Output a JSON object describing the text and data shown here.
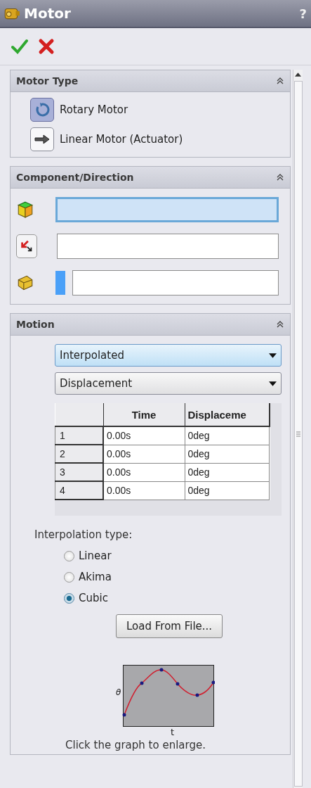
{
  "window": {
    "title": "Motor",
    "help": "?"
  },
  "sections": [
    {
      "kind": "motor_type",
      "title": "Motor Type",
      "expanded": true,
      "options": [
        {
          "label": "Rotary Motor",
          "selected": true
        },
        {
          "label": "Linear Motor (Actuator)",
          "selected": false
        }
      ]
    },
    {
      "kind": "component",
      "title": "Component/Direction",
      "expanded": true,
      "fields": [
        {
          "active": true
        },
        {
          "active": false
        },
        {
          "active": false
        }
      ]
    },
    {
      "kind": "motion",
      "title": "Motion",
      "expanded": true,
      "dropdowns": [
        {
          "value": "Interpolated",
          "active": true
        },
        {
          "value": "Displacement",
          "active": false
        }
      ],
      "table": {
        "columns": [
          "",
          "Time",
          "Displaceme"
        ],
        "rows": [
          [
            "1",
            "0.00s",
            "0deg"
          ],
          [
            "2",
            "0.00s",
            "0deg"
          ],
          [
            "3",
            "0.00s",
            "0deg"
          ],
          [
            "4",
            "0.00s",
            "0deg"
          ]
        ]
      },
      "interpolation_label": "Interpolation type:",
      "radios": [
        {
          "label": "Linear",
          "selected": false
        },
        {
          "label": "Akima",
          "selected": false
        },
        {
          "label": "Cubic",
          "selected": true
        }
      ],
      "button": "Load From File...",
      "graph": {
        "ylabel": "θ",
        "xlabel": "t"
      },
      "caption": "Click the graph to enlarge."
    }
  ]
}
